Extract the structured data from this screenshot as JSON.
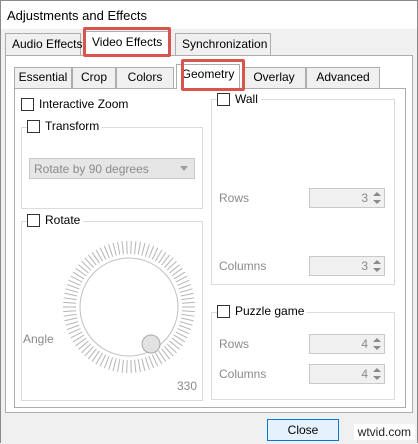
{
  "window": {
    "title": "Adjustments and Effects"
  },
  "outer_tabs": [
    {
      "label": "Audio Effects",
      "active": false
    },
    {
      "label": "Video Effects",
      "active": true
    },
    {
      "label": "Synchronization",
      "active": false
    }
  ],
  "inner_tabs": [
    {
      "label": "Essential",
      "active": false
    },
    {
      "label": "Crop",
      "active": false
    },
    {
      "label": "Colors",
      "active": false
    },
    {
      "label": "Geometry",
      "active": true
    },
    {
      "label": "Overlay",
      "active": false
    },
    {
      "label": "Advanced",
      "active": false
    }
  ],
  "geometry": {
    "interactive_zoom": {
      "label": "Interactive Zoom",
      "checked": false
    },
    "transform": {
      "label": "Transform",
      "checked": false,
      "combo_value": "Rotate by 90 degrees"
    },
    "rotate": {
      "label": "Rotate",
      "checked": false,
      "angle_label": "Angle",
      "angle_value": "330"
    },
    "wall": {
      "label": "Wall",
      "checked": false,
      "rows_label": "Rows",
      "rows_value": "3",
      "columns_label": "Columns",
      "columns_value": "3"
    },
    "puzzle": {
      "label": "Puzzle game",
      "checked": false,
      "rows_label": "Rows",
      "rows_value": "4",
      "columns_label": "Columns",
      "columns_value": "4"
    }
  },
  "buttons": {
    "close": "Close"
  },
  "watermark": "wtvid.com",
  "colors": {
    "highlight": "#d9534f",
    "default_button_border": "#0078d7"
  }
}
